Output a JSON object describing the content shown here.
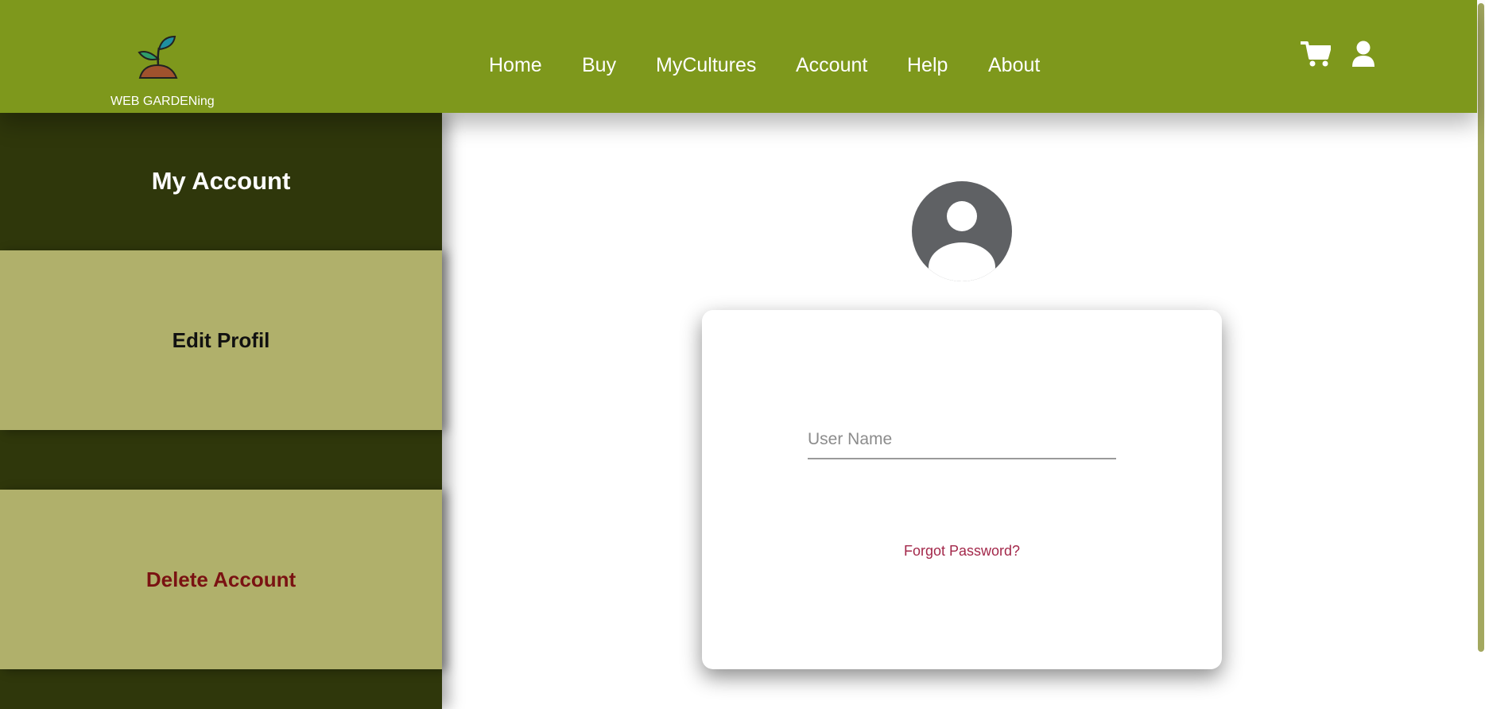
{
  "header": {
    "brand": "WEB GARDENing",
    "nav": [
      "Home",
      "Buy",
      "MyCultures",
      "Account",
      "Help",
      "About"
    ],
    "icons": {
      "cart": "cart-icon",
      "user": "user-icon",
      "logo": "sprout-logo-icon"
    }
  },
  "sidebar": {
    "title": "My Account",
    "edit_label": "Edit Profil",
    "delete_label": "Delete Account"
  },
  "main": {
    "avatar_icon": "user-avatar-icon",
    "username_placeholder": "User Name",
    "username_value": "",
    "forgot_label": "Forgot Password?"
  },
  "colors": {
    "header": "#7e981c",
    "sidebar_dark": "#2f370b",
    "sidebar_panel": "#b0b06b",
    "delete_text": "#7a1212",
    "link": "#a3284a",
    "avatar": "#5f6164"
  }
}
